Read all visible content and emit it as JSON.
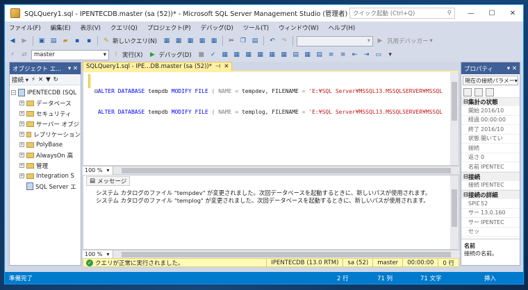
{
  "window": {
    "title": "SQLQuery1.sql - IPENTECDB.master (sa (52))* - Microsoft SQL Server Management Studio (管理者)",
    "quick_launch": "クイック起動 (Ctrl+Q)"
  },
  "menu": [
    "ファイル(F)",
    "編集(E)",
    "表示(V)",
    "クエリ(Q)",
    "プロジェクト(P)",
    "デバッグ(D)",
    "ツール(T)",
    "ウィンドウ(W)",
    "ヘルプ(H)"
  ],
  "toolbar1": {
    "new_query": "新しいクエリ(N)",
    "generic_debugger": "汎用デバッガー"
  },
  "toolbar2": {
    "database": "master",
    "execute": "実行(X)",
    "debug": "デバッグ(D)"
  },
  "object_explorer": {
    "title": "オブジェクト エ...",
    "connect": "接続",
    "root": "IPENTECDB (SQL",
    "items": [
      "データベース",
      "セキュリティ",
      "サーバー オブジ",
      "レプリケーション",
      "PolyBase",
      "AlwaysOn 高",
      "管理",
      "Integration S",
      "SQL Server エ"
    ]
  },
  "editor": {
    "tab_label": "SQLQuery1.sql - IPE...DB.master (sa (52))*",
    "line1": {
      "kw1": "ALTER DATABASE",
      "t1": " tempdb ",
      "kw2": "MODIFY FILE",
      "t2": " ( NAME ",
      "op1": "=",
      "t3": " tempdev, FILENAME ",
      "op2": "=",
      "str": " 'E:¥SQL Server¥MSSQL13.MSSQLSERVER¥MSSQL"
    },
    "line2": {
      "kw1": "ALTER DATABASE",
      "t1": " tempdb ",
      "kw2": "MODIFY FILE",
      "t2": " ( NAME ",
      "op1": "=",
      "t3": " templog, FILENAME ",
      "op2": "=",
      "str": " 'E:¥SQL Server¥MSSQL13.MSSQLSERVER¥MSSQL"
    },
    "zoom": "100 %"
  },
  "results": {
    "tab": "メッセージ",
    "lines": [
      "システム カタログのファイル \"tempdev\" が変更されました。次回データベースを起動するときに、新しいパスが使用されます。",
      "システム カタログのファイル \"templog\" が変更されました。次回データベースを起動するときに、新しいパスが使用されます。"
    ],
    "zoom": "100 %"
  },
  "query_status": {
    "message": "クエリが正常に実行されました。",
    "server": "IPENTECDB (13.0 RTM)",
    "user": "sa (52)",
    "database": "master",
    "elapsed": "00:00:00",
    "rows": "0 行"
  },
  "properties": {
    "title": "プロパティ",
    "selector": "現在の接続パラメー",
    "cat1": "集計の状態",
    "rows1": [
      {
        "k": "開始時",
        "v": "2016/10"
      },
      {
        "k": "経過時",
        "v": "00:00:00"
      },
      {
        "k": "終了時",
        "v": "2016/10"
      },
      {
        "k": "状態",
        "v": "開いてい"
      },
      {
        "k": "接続エ",
        "v": ""
      },
      {
        "k": "返され",
        "v": "0"
      },
      {
        "k": "名前",
        "v": "IPENTEC"
      }
    ],
    "cat2": "接続",
    "rows2": [
      {
        "k": "接続名",
        "v": "IPENTEC"
      }
    ],
    "cat3": "接続の詳細",
    "rows3": [
      {
        "k": "SPID",
        "v": "52"
      },
      {
        "k": "サーバー",
        "v": "13.0.160"
      },
      {
        "k": "サーバー",
        "v": "IPENTEC"
      },
      {
        "k": "セッシ",
        "v": ""
      }
    ],
    "desc_title": "名前",
    "desc_text": "接続の名前。"
  },
  "statusbar": {
    "ready": "準備完了",
    "line": "2 行",
    "col": "71 列",
    "char": "71 文字",
    "mode": "挿入"
  }
}
